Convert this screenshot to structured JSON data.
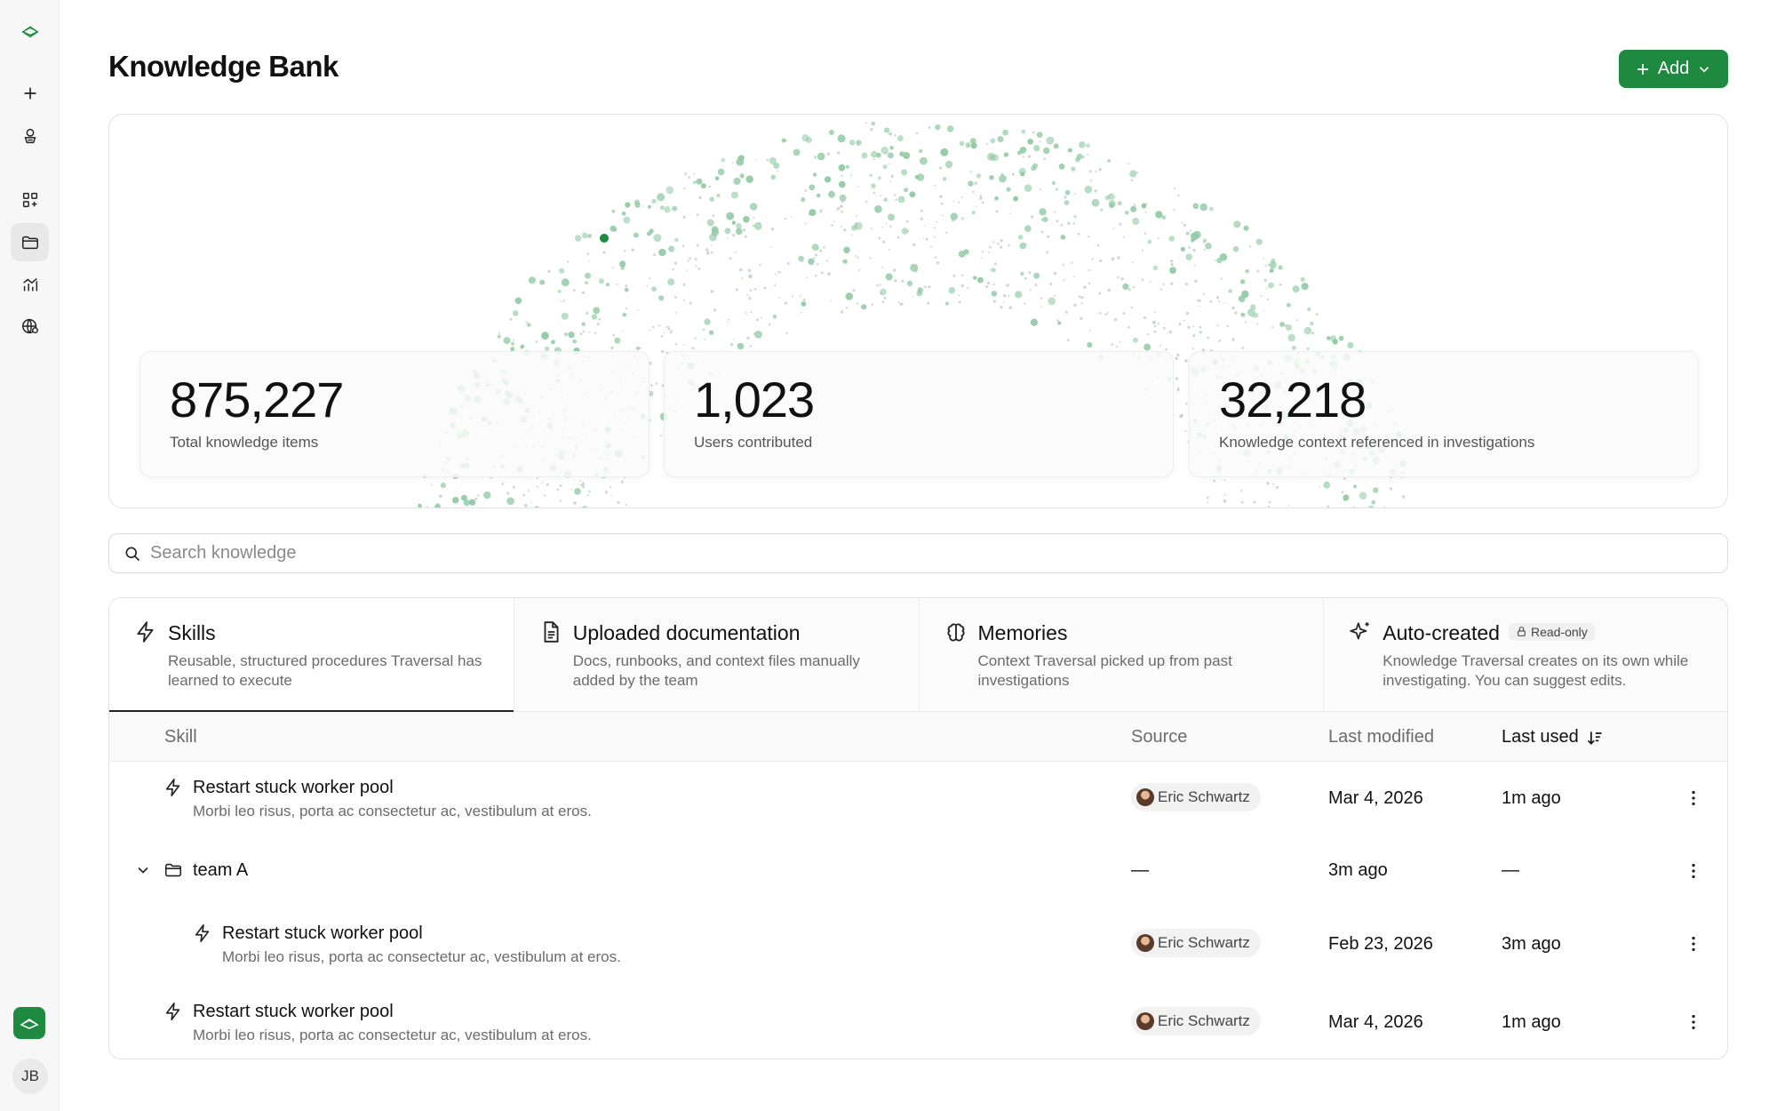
{
  "sidebar": {
    "items": [
      {
        "name": "brand-logo-icon"
      },
      {
        "name": "new-icon"
      },
      {
        "name": "agent-icon"
      },
      {
        "name": "apps-icon"
      },
      {
        "name": "folder-icon",
        "active": true
      },
      {
        "name": "analytics-icon"
      },
      {
        "name": "globe-settings-icon"
      }
    ],
    "user_initials": "JB"
  },
  "header": {
    "title": "Knowledge Bank",
    "add_label": "Add"
  },
  "stats": [
    {
      "value": "875,227",
      "label": "Total knowledge items"
    },
    {
      "value": "1,023",
      "label": "Users contributed"
    },
    {
      "value": "32,218",
      "label": "Knowledge context referenced in investigations"
    }
  ],
  "search": {
    "placeholder": "Search knowledge"
  },
  "tabs": [
    {
      "title": "Skills",
      "description": "Reusable, structured procedures Traversal has learned to execute",
      "icon": "lightning-icon",
      "active": true
    },
    {
      "title": "Uploaded documentation",
      "description": "Docs, runbooks, and context files manually added by the team",
      "icon": "document-icon"
    },
    {
      "title": "Memories",
      "description": "Context Traversal picked up from past investigations",
      "icon": "brain-icon"
    },
    {
      "title": "Auto-created",
      "badge": "Read-only",
      "description": "Knowledge Traversal creates on its own while investigating. You can suggest edits.",
      "icon": "sparkle-icon"
    }
  ],
  "table": {
    "columns": {
      "skill": "Skill",
      "source": "Source",
      "last_modified": "Last modified",
      "last_used": "Last used"
    },
    "rows": [
      {
        "title": "Restart stuck worker pool",
        "description": "Morbi leo risus, porta ac consectetur ac, vestibulum at eros.",
        "source": "Eric Schwartz",
        "last_modified": "Mar 4, 2026",
        "last_used": "1m ago"
      },
      {
        "title": "team A",
        "source": "—",
        "last_modified": "3m ago",
        "last_used": "—"
      },
      {
        "title": "Restart stuck worker pool",
        "description": "Morbi leo risus, porta ac consectetur ac, vestibulum at eros.",
        "source": "Eric Schwartz",
        "last_modified": "Feb 23, 2026",
        "last_used": "3m ago"
      },
      {
        "title": "Restart stuck worker pool",
        "description": "Morbi leo risus, porta ac consectetur ac, vestibulum at eros.",
        "source": "Eric Schwartz",
        "last_modified": "Mar 4, 2026",
        "last_used": "1m ago"
      }
    ]
  },
  "colors": {
    "accent": "#1d8a3f",
    "dot": "#8fc9a3",
    "dot_strong": "#1d8a3f"
  }
}
